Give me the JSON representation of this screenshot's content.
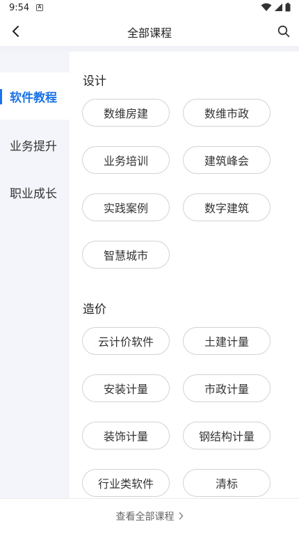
{
  "status_bar": {
    "time": "9:54",
    "notification_glyph": "A",
    "icons": [
      "wifi-icon",
      "signal-icon",
      "battery-icon"
    ]
  },
  "nav": {
    "title": "全部课程",
    "back_icon": "chevron-left-icon",
    "search_icon": "search-icon"
  },
  "sidebar": {
    "items": [
      {
        "label": "软件教程",
        "active": true
      },
      {
        "label": "业务提升",
        "active": false
      },
      {
        "label": "职业成长",
        "active": false
      }
    ]
  },
  "sections": [
    {
      "title": "设计",
      "chips": [
        "数维房建",
        "数维市政",
        "业务培训",
        "建筑峰会",
        "实践案例",
        "数字建筑",
        "智慧城市"
      ]
    },
    {
      "title": "造价",
      "chips": [
        "云计价软件",
        "土建计量",
        "安装计量",
        "市政计量",
        "装饰计量",
        "钢结构计量",
        "行业类软件",
        "清标"
      ]
    }
  ],
  "footer": {
    "label": "查看全部课程",
    "arrow_icon": "chevron-right-icon"
  },
  "colors": {
    "accent": "#1a73e8",
    "sidebar_bg": "#f4f5fa",
    "chip_border": "#cfd2d8"
  }
}
